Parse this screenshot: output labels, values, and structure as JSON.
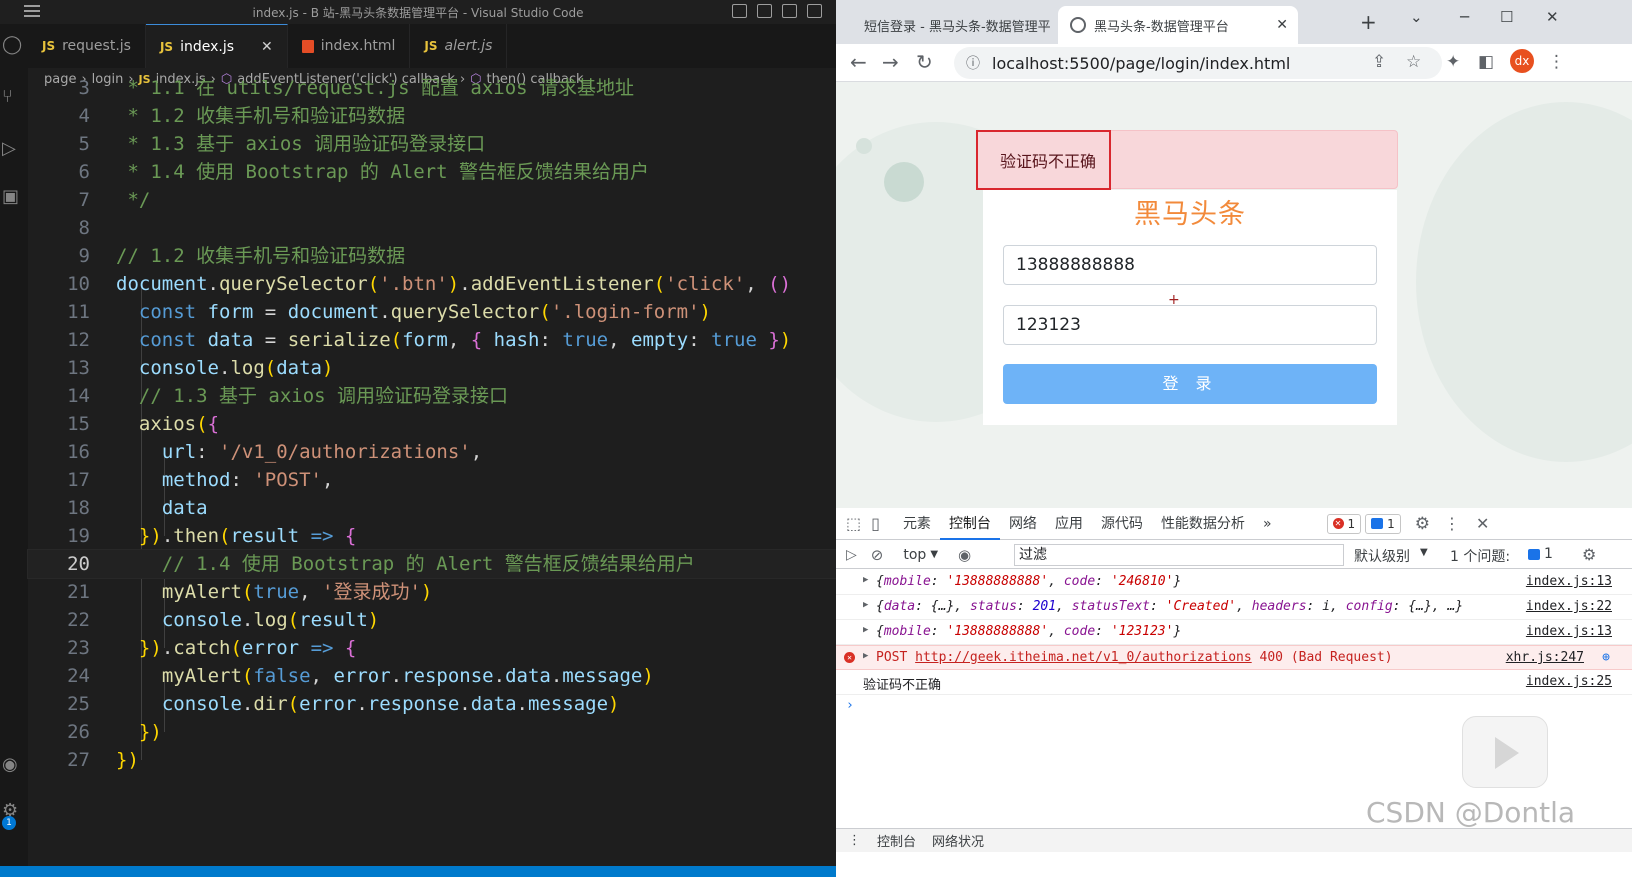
{
  "vscode": {
    "window_title": "index.js - B 站-黑马头条数据管理平台 - Visual Studio Code",
    "tabs": [
      {
        "icon": "JS",
        "label": "request.js",
        "active": false
      },
      {
        "icon": "JS",
        "label": "index.js",
        "active": true,
        "close": "✕"
      },
      {
        "icon": "html",
        "label": "index.html",
        "active": false
      },
      {
        "icon": "JS",
        "label": "alert.js",
        "active": false
      }
    ],
    "breadcrumb": [
      "page",
      "login",
      "index.js",
      "addEventListener('click') callback",
      "then() callback"
    ],
    "breadcrumb_js": "JS",
    "lines": [
      {
        "num": "3",
        "code": " * 1.1 在 utils/request.js 配置 axios 请求基地址"
      },
      {
        "num": "4",
        "code": " * 1.2 收集手机号和验证码数据"
      },
      {
        "num": "5",
        "code": " * 1.3 基于 axios 调用验证码登录接口"
      },
      {
        "num": "6",
        "code": " * 1.4 使用 Bootstrap 的 Alert 警告框反馈结果给用户"
      },
      {
        "num": "7",
        "code": " */"
      },
      {
        "num": "8",
        "code": ""
      },
      {
        "num": "9",
        "code": "// 1.2 收集手机号和验证码数据"
      },
      {
        "num": "10",
        "code": "document.querySelector('.btn').addEventListener('click', ()"
      },
      {
        "num": "11",
        "code": "  const form = document.querySelector('.login-form')"
      },
      {
        "num": "12",
        "code": "  const data = serialize(form, { hash: true, empty: true })"
      },
      {
        "num": "13",
        "code": "  console.log(data)"
      },
      {
        "num": "14",
        "code": "  // 1.3 基于 axios 调用验证码登录接口"
      },
      {
        "num": "15",
        "code": "  axios({"
      },
      {
        "num": "16",
        "code": "    url: '/v1_0/authorizations',"
      },
      {
        "num": "17",
        "code": "    method: 'POST',"
      },
      {
        "num": "18",
        "code": "    data"
      },
      {
        "num": "19",
        "code": "  }).then(result => {"
      },
      {
        "num": "20",
        "code": "    // 1.4 使用 Bootstrap 的 Alert 警告框反馈结果给用户"
      },
      {
        "num": "21",
        "code": "    myAlert(true, '登录成功')"
      },
      {
        "num": "22",
        "code": "    console.log(result)"
      },
      {
        "num": "23",
        "code": "  }).catch(error => {"
      },
      {
        "num": "24",
        "code": "    myAlert(false, error.response.data.message)"
      },
      {
        "num": "25",
        "code": "    console.dir(error.response.data.message)"
      },
      {
        "num": "26",
        "code": "  })"
      },
      {
        "num": "27",
        "code": "})"
      }
    ],
    "current_line": "20",
    "status_badge": "1"
  },
  "browser": {
    "tabs": [
      {
        "label": "短信登录 - 黑马头条-数据管理平",
        "close": "✕",
        "active": false
      },
      {
        "label": "黑马头条-数据管理平台",
        "close": "✕",
        "active": true
      }
    ],
    "new_tab": "+",
    "url": "localhost:5500/page/login/index.html",
    "avatar": "dx"
  },
  "page": {
    "alert_text": "验证码不正确",
    "brand": "黑马头条",
    "mobile_value": "13888888888",
    "code_value": "123123",
    "login_button": "登 录"
  },
  "devtools": {
    "tabs": [
      "元素",
      "控制台",
      "网络",
      "应用",
      "源代码",
      "性能数据分析"
    ],
    "active_tab": "控制台",
    "more": "»",
    "error_count": "1",
    "info_count": "1",
    "context": "top",
    "filter_placeholder": "过滤",
    "levels": "默认级别",
    "issues_label": "1 个问题:",
    "issues_count": "1",
    "rows": [
      {
        "type": "object",
        "text": "{mobile: '13888888888', code: '246810'}",
        "src": "index.js:13"
      },
      {
        "type": "object",
        "text": "{data: {…}, status: 201, statusText: 'Created', headers: i, config: {…}, …}",
        "src": "index.js:22"
      },
      {
        "type": "object",
        "text": "{mobile: '13888888888', code: '123123'}",
        "src": "index.js:13"
      },
      {
        "type": "error",
        "text": "POST http://geek.itheima.net/v1_0/authorizations 400 (Bad Request)",
        "src": "xhr.js:247"
      },
      {
        "type": "log",
        "text": "验证码不正确",
        "src": "index.js:25"
      }
    ],
    "prompt": "›",
    "bottom_tabs": [
      "控制台",
      "网络状况"
    ],
    "watermark": "CSDN @Dontla"
  },
  "colors": {
    "vscode_bg": "#1e1e1e",
    "status_bar": "#007acc",
    "alert_bg": "#f8d7da",
    "brand": "#f28a3b",
    "login_button": "#6eb3f7",
    "error_row": "#fdeded"
  }
}
